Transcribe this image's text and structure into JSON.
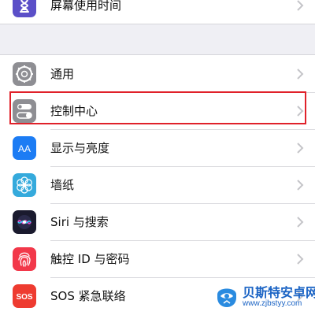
{
  "top_item": {
    "label": "屏幕使用时间",
    "icon": "hourglass-icon",
    "icon_color": "#5b4fc8"
  },
  "items": [
    {
      "label": "通用",
      "icon": "gear-icon",
      "icon_color": "#8e8e93"
    },
    {
      "label": "控制中心",
      "icon": "toggles-icon",
      "icon_color": "#8e8e93"
    },
    {
      "label": "显示与亮度",
      "icon": "text-size-icon",
      "icon_color": "#1c7cf4"
    },
    {
      "label": "墙纸",
      "icon": "flower-icon",
      "icon_color": "#35aadc"
    },
    {
      "label": "Siri 与搜索",
      "icon": "siri-icon",
      "icon_color": "#1a1a2e"
    },
    {
      "label": "触控 ID 与密码",
      "icon": "fingerprint-icon",
      "icon_color": "#f2384a"
    },
    {
      "label": "SOS 紧急联络",
      "icon": "sos-icon",
      "icon_color": "#ee3b30",
      "icon_text": "SOS"
    }
  ],
  "display_icon_text": "AA",
  "highlight_color": "#e0212a",
  "watermark": {
    "title": "贝斯特安卓网",
    "url": "www.zjbstyy.com"
  }
}
